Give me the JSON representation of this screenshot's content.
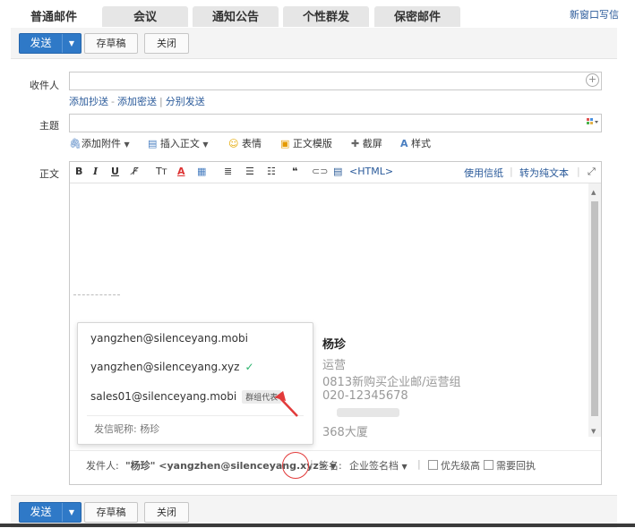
{
  "tabs": [
    {
      "label": "普通邮件",
      "active": true
    },
    {
      "label": "会议",
      "active": false
    },
    {
      "label": "通知公告",
      "active": false
    },
    {
      "label": "个性群发",
      "active": false
    },
    {
      "label": "保密邮件",
      "active": false
    }
  ],
  "header": {
    "new_window": "新窗口写信"
  },
  "toolbar": {
    "send": "发送",
    "save_draft": "存草稿",
    "close": "关闭"
  },
  "form": {
    "recipient_label": "收件人",
    "add_cc": "添加抄送",
    "add_bcc": "添加密送",
    "separate_send": "分别发送",
    "link_sep1": "-",
    "link_sep2": "|",
    "subject_label": "主题",
    "body_label": "正文"
  },
  "attach_bar": {
    "add_attachment": "添加附件",
    "insert_body": "插入正文",
    "emoji": "表情",
    "template": "正文模版",
    "screenshot": "截屏",
    "style": "样式"
  },
  "editor_toolbar": {
    "bold": "B",
    "italic": "I",
    "underline": "U",
    "html": "<HTML>",
    "use_letterhead": "使用信纸",
    "to_plain": "转为纯文本"
  },
  "signature": {
    "name": "杨珍",
    "title": "运营",
    "dept": "0813新购买企业邮/运营组",
    "phone": "020-12345678",
    "location": "368大厦"
  },
  "sender_row": {
    "sender_label": "发件人:",
    "sender_value": "\"杨珍\" <yangzhen@silenceyang.xyz>",
    "sender_caret": "▼",
    "sep": "|",
    "signature_label": "签名:",
    "signature_value": "企业签名档",
    "priority": "优先级高",
    "receipt": "需要回执"
  },
  "dropdown": {
    "items": [
      {
        "email": "yangzhen@silenceyang.mobi"
      },
      {
        "email": "yangzhen@silenceyang.xyz",
        "check": "✓"
      },
      {
        "email": "sales01@silenceyang.mobi",
        "badge": "群组代表"
      }
    ],
    "nickname": "发信昵称: 杨珍"
  },
  "colors": {
    "accent": "#2f79c7",
    "link": "#2a5a9a",
    "annotation": "#e23b3b",
    "check": "#2bb36d"
  }
}
